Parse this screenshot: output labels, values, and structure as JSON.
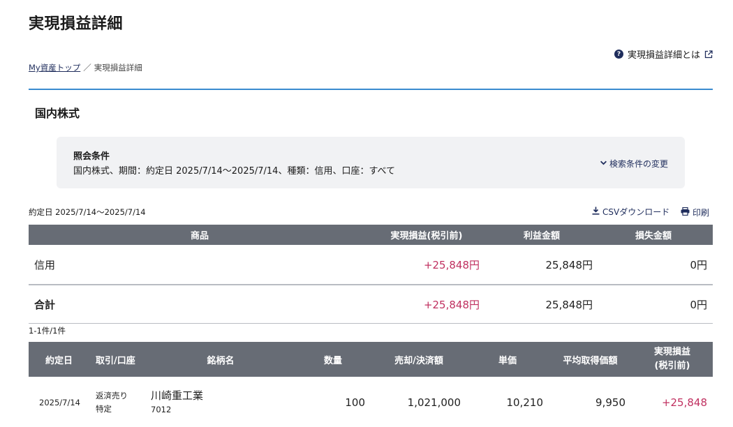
{
  "page": {
    "title": "実現損益詳細",
    "help_link": "実現損益詳細とは",
    "breadcrumb": {
      "home": "My資産トップ",
      "separator": "／",
      "current": "実現損益詳細"
    }
  },
  "section": {
    "title": "国内株式"
  },
  "conditions": {
    "label": "照会条件",
    "text": "国内株式、期間：約定日 2025/7/14～2025/7/14、種類：信用、口座：すべて",
    "change_link": "検索条件の変更"
  },
  "toolbar": {
    "period": "約定日 2025/7/14～2025/7/14",
    "csv": "CSVダウンロード",
    "print": "印刷"
  },
  "summary_table": {
    "headers": {
      "product": "商品",
      "realized": "実現損益(税引前)",
      "profit": "利益金額",
      "loss": "損失金額"
    },
    "rows": [
      {
        "product": "信用",
        "realized": "+25,848円",
        "profit": "25,848円",
        "loss": "0円"
      }
    ],
    "total": {
      "label": "合計",
      "realized": "+25,848円",
      "profit": "25,848円",
      "loss": "0円"
    }
  },
  "result_count": "1-1件/1件",
  "detail_table": {
    "headers": {
      "date": "約定日",
      "trade": "取引/口座",
      "name": "銘柄名",
      "qty": "数量",
      "amount": "売却/決済額",
      "price": "単価",
      "avg": "平均取得価額",
      "realized_line1": "実現損益",
      "realized_line2": "(税引前)"
    },
    "rows": [
      {
        "date": "2025/7/14",
        "trade": "返済売り",
        "account": "特定",
        "name": "川崎重工業",
        "code": "7012",
        "qty": "100",
        "amount": "1,021,000",
        "price": "10,210",
        "avg": "9,950",
        "realized": "+25,848"
      }
    ]
  },
  "colors": {
    "header_bg": "#676c75",
    "accent_blue": "#3a8bd0",
    "positive": "#c03060",
    "link": "#1f2d5c"
  }
}
